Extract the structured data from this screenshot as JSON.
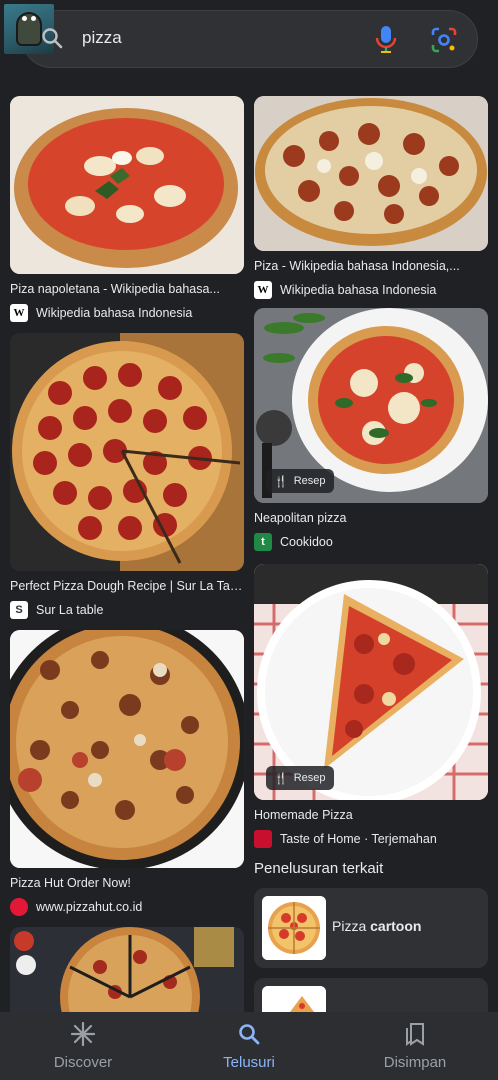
{
  "search": {
    "query": "pizza"
  },
  "results_left": [
    {
      "title": "Piza napoletana - Wikipedia bahasa...",
      "source": "Wikipedia bahasa Indonesia",
      "favicon": "W"
    },
    {
      "title": "Perfect Pizza Dough Recipe | Sur La Table",
      "source": "Sur La table",
      "favicon": "S"
    },
    {
      "title": "Pizza Hut Order Now!",
      "source": "www.pizzahut.co.id",
      "favicon": ""
    }
  ],
  "results_right": [
    {
      "title": "Piza - Wikipedia bahasa Indonesia,...",
      "source": "Wikipedia bahasa Indonesia",
      "favicon": "W"
    },
    {
      "title": "Neapolitan pizza",
      "source": "Cookidoo",
      "favicon": "t",
      "chip": "Resep"
    },
    {
      "title": "Homemade Pizza",
      "source": "Taste of Home · Terjemahan",
      "favicon": "",
      "chip": "Resep"
    }
  ],
  "related": {
    "heading": "Penelusuran terkait",
    "items": [
      {
        "prefix": "Pizza ",
        "bold": "cartoon"
      },
      {
        "prefix": "",
        "bold": ""
      }
    ]
  },
  "nav": {
    "items": [
      {
        "label": "Discover",
        "icon": "asterisk-icon"
      },
      {
        "label": "Telusuri",
        "icon": "search-icon",
        "active": true
      },
      {
        "label": "Disimpan",
        "icon": "bookmarks-icon"
      }
    ]
  },
  "colors": {
    "accent": "#8ab4f8",
    "background": "#202124"
  }
}
